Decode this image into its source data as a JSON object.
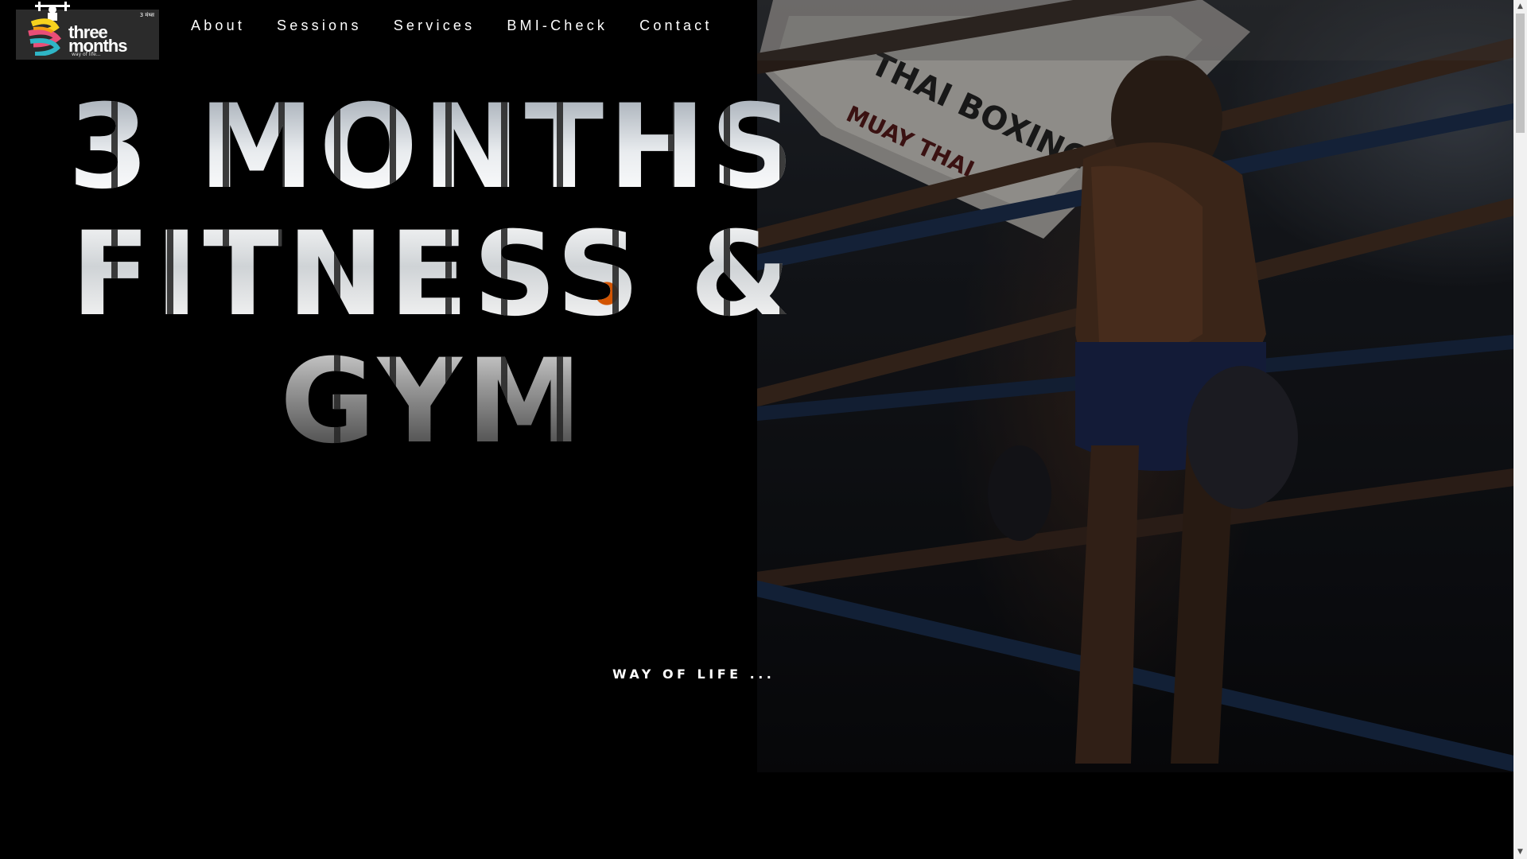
{
  "logo": {
    "primary_text": "three",
    "secondary_text": "months",
    "tagline_text": "way of life...",
    "corner_tag": "3 मंथ्स",
    "brand_colors": [
      "#f7d21e",
      "#e94e77",
      "#2fb5c6",
      "#f39c12"
    ]
  },
  "nav": {
    "items": [
      {
        "label": "About"
      },
      {
        "label": "Sessions"
      },
      {
        "label": "Services"
      },
      {
        "label": "BMI-Check"
      },
      {
        "label": "Contact"
      }
    ]
  },
  "hero": {
    "title_line1": "3 MONTHS",
    "title_line2": "FITNESS &",
    "title_line3": "GYM",
    "tagline": "WAY OF LIFE ...",
    "image_subject": "boxer in ring",
    "accent_color": "#ffffff",
    "background_color": "#000000"
  },
  "scrollbar": {
    "up_arrow": "▲",
    "down_arrow": "▼"
  }
}
